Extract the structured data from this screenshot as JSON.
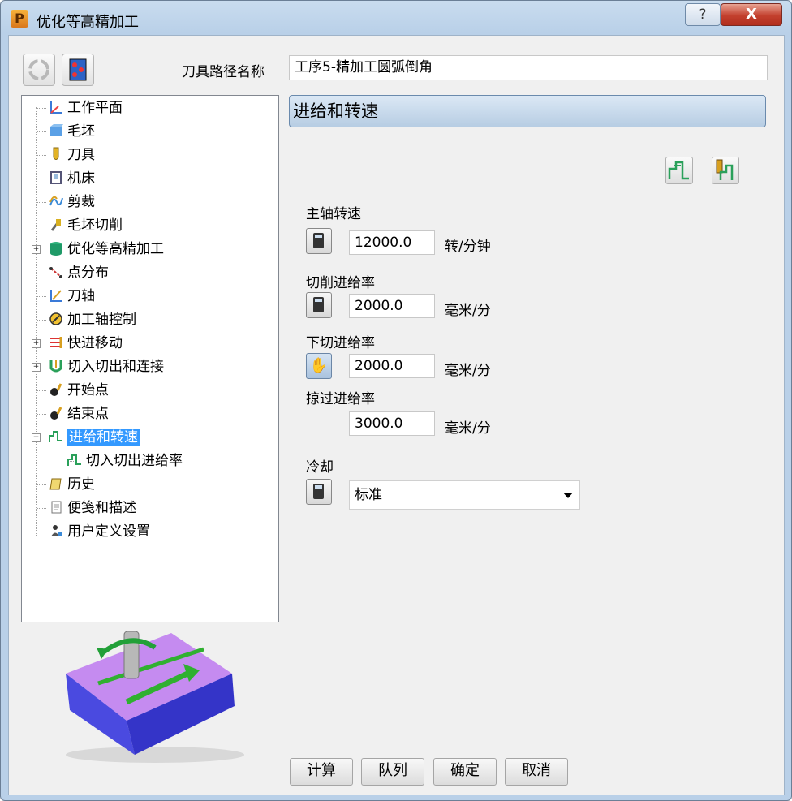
{
  "window": {
    "title": "优化等高精加工",
    "app_icon_letter": "P",
    "help_label": "?",
    "close_label": "X"
  },
  "toolpath_name": {
    "label": "刀具路径名称",
    "value": "工序5-精加工圆弧倒角"
  },
  "tree": {
    "items": [
      {
        "label": "工作平面",
        "icon": "workplane-icon"
      },
      {
        "label": "毛坯",
        "icon": "block-icon"
      },
      {
        "label": "刀具",
        "icon": "tool-icon"
      },
      {
        "label": "机床",
        "icon": "machine-icon"
      },
      {
        "label": "剪裁",
        "icon": "limit-icon"
      },
      {
        "label": "毛坯切削",
        "icon": "stock-cut-icon"
      },
      {
        "label": "优化等高精加工",
        "icon": "strategy-icon"
      },
      {
        "label": "点分布",
        "icon": "point-distribution-icon"
      },
      {
        "label": "刀轴",
        "icon": "tool-axis-icon"
      },
      {
        "label": "加工轴控制",
        "icon": "axis-control-icon"
      },
      {
        "label": "快进移动",
        "icon": "rapid-move-icon"
      },
      {
        "label": "切入切出和连接",
        "icon": "leads-links-icon"
      },
      {
        "label": "开始点",
        "icon": "start-point-icon"
      },
      {
        "label": "结束点",
        "icon": "end-point-icon"
      },
      {
        "label": "进给和转速",
        "icon": "feeds-speeds-icon"
      },
      {
        "label": "切入切出进给率",
        "icon": "lead-feed-icon"
      },
      {
        "label": "历史",
        "icon": "history-icon"
      },
      {
        "label": "便笺和描述",
        "icon": "notes-icon"
      },
      {
        "label": "用户定义设置",
        "icon": "user-settings-icon"
      }
    ]
  },
  "panel": {
    "title": "进给和转速",
    "spindle": {
      "label": "主轴转速",
      "value": "12000.0",
      "unit": "转/分钟"
    },
    "cutting_feed": {
      "label": "切削进给率",
      "value": "2000.0",
      "unit": "毫米/分"
    },
    "plunge_feed": {
      "label": "下切进给率",
      "value": "2000.0",
      "unit": "毫米/分"
    },
    "skim_feed": {
      "label": "掠过进给率",
      "value": "3000.0",
      "unit": "毫米/分"
    },
    "coolant": {
      "label": "冷却",
      "value": "标准"
    }
  },
  "buttons": {
    "calculate": "计算",
    "queue": "队列",
    "ok": "确定",
    "cancel": "取消"
  }
}
